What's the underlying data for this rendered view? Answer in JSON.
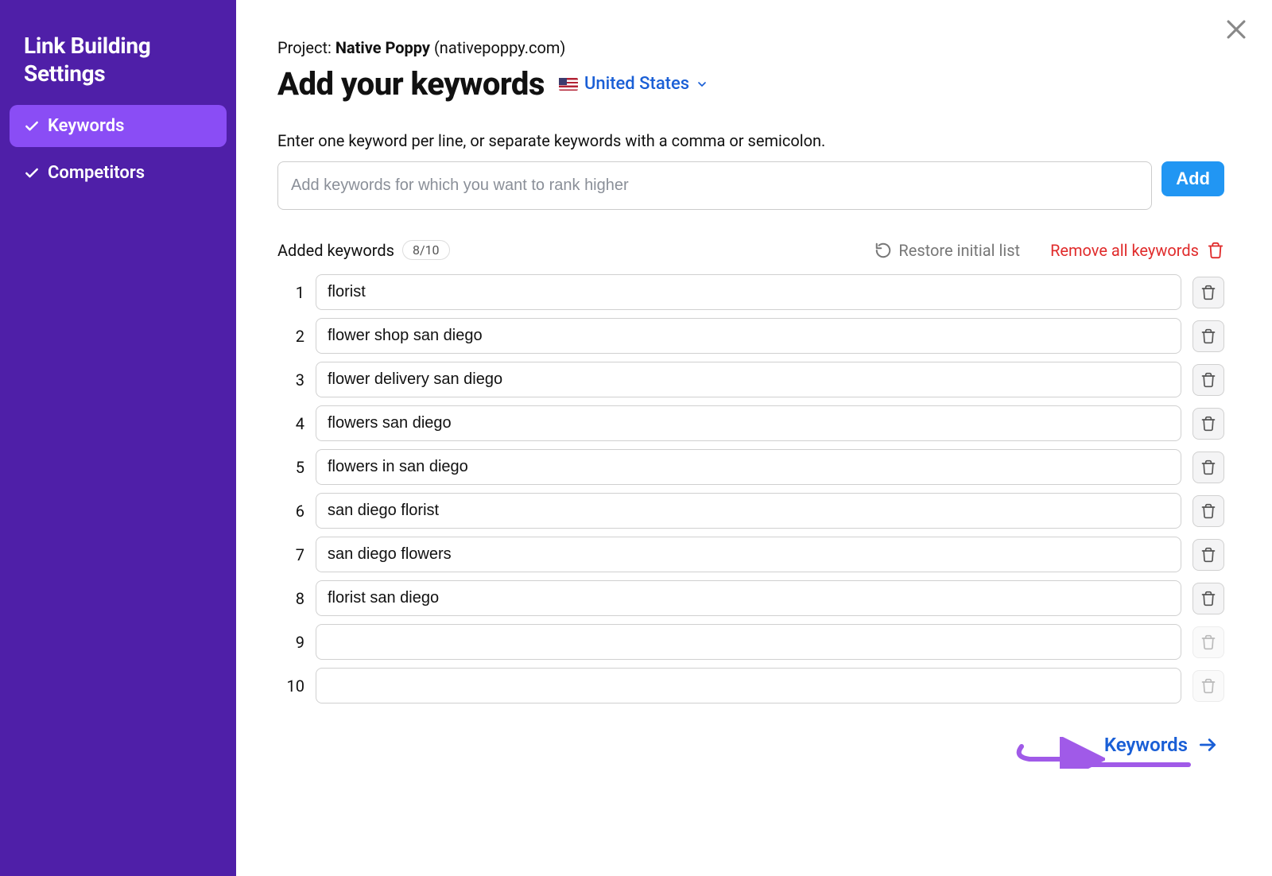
{
  "sidebar": {
    "title": "Link Building Settings",
    "items": [
      {
        "label": "Keywords",
        "active": true
      },
      {
        "label": "Competitors",
        "active": false
      }
    ]
  },
  "project": {
    "prefix": "Project: ",
    "name": "Native Poppy",
    "domain_suffix": " (nativepoppy.com)"
  },
  "title": "Add your keywords",
  "country": "United States",
  "instruction": "Enter one keyword per line, or separate keywords with a comma or semicolon.",
  "input": {
    "placeholder": "Add keywords for which you want to rank higher",
    "add_label": "Add"
  },
  "added": {
    "label": "Added keywords",
    "count": "8/10",
    "restore": "Restore initial list",
    "remove_all": "Remove all keywords"
  },
  "keywords": [
    "florist",
    "flower shop san diego",
    "flower delivery san diego",
    "flowers san diego",
    "flowers in san diego",
    "san diego florist",
    "san diego flowers",
    "florist san diego",
    "",
    ""
  ],
  "next_label": "Keywords"
}
